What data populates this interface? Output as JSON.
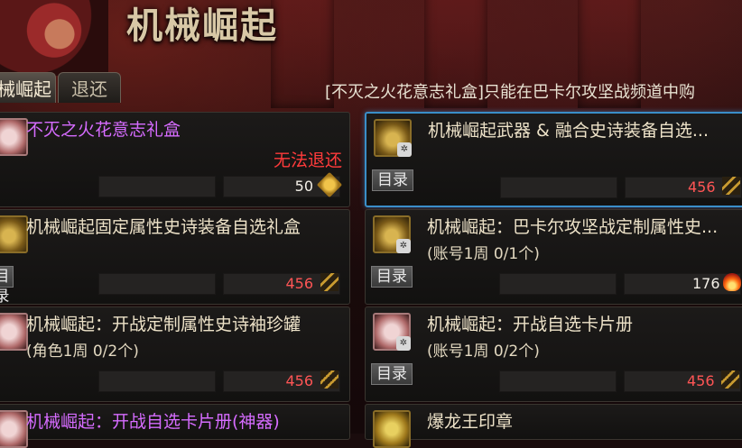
{
  "header": {
    "title": "机械崛起"
  },
  "tabs": [
    {
      "label": "械崛起",
      "active": true
    },
    {
      "label": "退还",
      "active": false
    }
  ],
  "notice": "[不灭之火花意志礼盒]只能在巴卡尔攻坚战频道中购",
  "labels": {
    "catalog": "目录"
  },
  "colors": {
    "selected_border": "#3a8ec8",
    "price_red": "#ff5555",
    "item_name_purple": "#d66cff",
    "refund_red": "#ff3b3b"
  },
  "items": [
    {
      "name": "不灭之火花意志礼盒",
      "sub": "",
      "refund": "无法退还",
      "price": "50",
      "currency_icon": "gold-gem-icon",
      "catalog": false
    },
    {
      "name": "机械崛起武器 & 融合史诗装备自选...",
      "sub": "",
      "price": "456",
      "currency_icon": "mechanical-coin-icon",
      "catalog": true,
      "selected": true
    },
    {
      "name": "机械崛起固定属性史诗装备自选礼盒",
      "sub": "",
      "price": "456",
      "currency_icon": "mechanical-coin-icon",
      "catalog": true
    },
    {
      "name": "机械崛起：巴卡尔攻坚战定制属性史...",
      "sub": "(账号1周 0/1个)",
      "price": "176",
      "currency_icon": "fire-spark-icon",
      "catalog": true
    },
    {
      "name": "机械崛起：开战定制属性史诗袖珍罐",
      "sub": "(角色1周 0/2个)",
      "price": "456",
      "currency_icon": "mechanical-coin-icon",
      "catalog": false
    },
    {
      "name": "机械崛起：开战自选卡片册",
      "sub": "(账号1周 0/2个)",
      "price": "456",
      "currency_icon": "mechanical-coin-icon",
      "catalog": true
    },
    {
      "name": "机械崛起：开战自选卡片册(神器)",
      "sub": ""
    },
    {
      "name": "爆龙王印章",
      "sub": ""
    }
  ]
}
